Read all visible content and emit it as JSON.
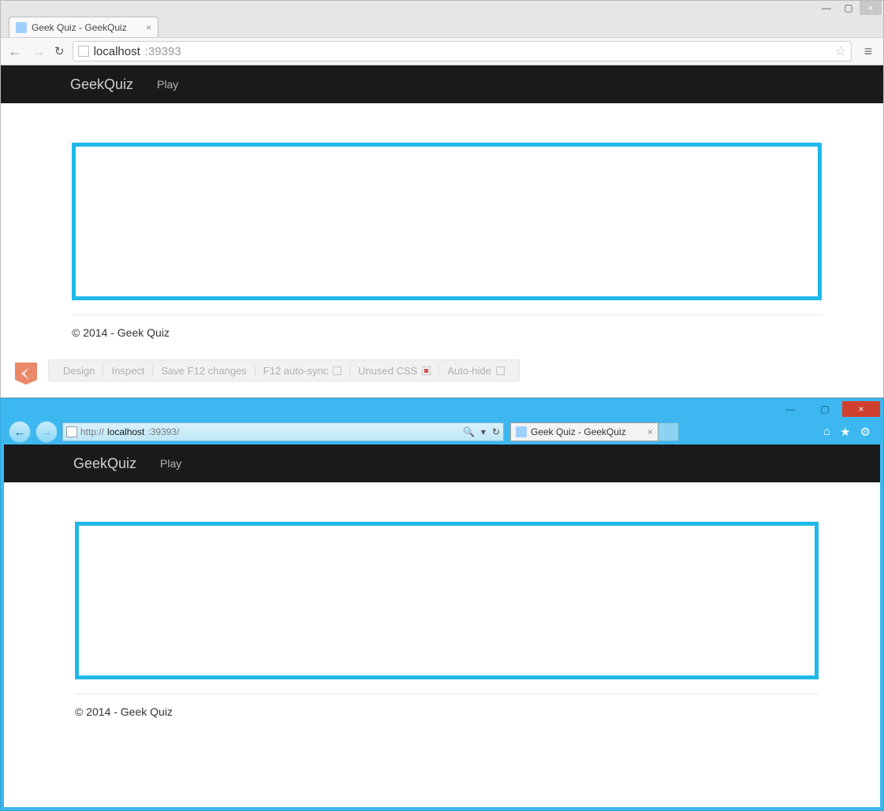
{
  "chrome": {
    "tab_title": "Geek Quiz - GeekQuiz",
    "url_host": "localhost",
    "url_rest": ":39393",
    "winbtn_min": "—",
    "winbtn_max": "▢",
    "winbtn_close": "×"
  },
  "ie": {
    "tab_title": "Geek Quiz - GeekQuiz",
    "url_prefix": "http://",
    "url_host": "localhost",
    "url_rest": ":39393/",
    "winbtn_min": "—",
    "winbtn_max": "▢",
    "winbtn_close": "×"
  },
  "app": {
    "brand": "GeekQuiz",
    "nav_play": "Play",
    "footer": "© 2014 - Geek Quiz"
  },
  "browserlink": {
    "design": "Design",
    "inspect": "Inspect",
    "save": "Save F12 changes",
    "autosync": "F12 auto-sync",
    "unused": "Unused CSS",
    "autohide": "Auto-hide"
  }
}
